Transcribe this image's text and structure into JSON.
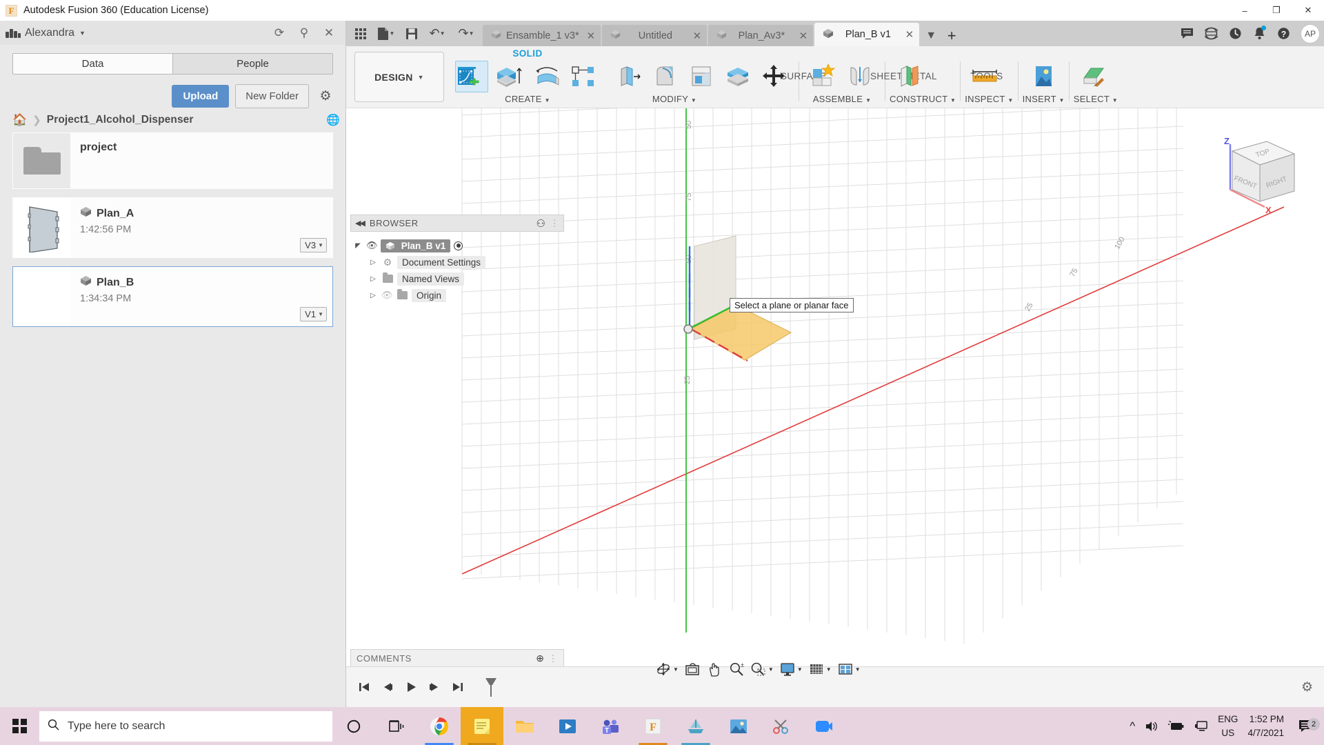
{
  "window": {
    "title": "Autodesk Fusion 360 (Education License)",
    "logo_letter": "F",
    "minimize": "–",
    "maximize": "❐",
    "close": "✕"
  },
  "data_panel": {
    "user": "Alexandra",
    "header_icons": [
      "refresh-icon",
      "search-icon",
      "close-icon"
    ],
    "tabs": [
      {
        "label": "Data",
        "active": true
      },
      {
        "label": "People",
        "active": false
      }
    ],
    "upload_label": "Upload",
    "new_folder_label": "New Folder",
    "breadcrumb": "Project1_Alcohol_Dispenser",
    "files": [
      {
        "name": "project",
        "time": "",
        "version": "",
        "type": "folder",
        "selected": false
      },
      {
        "name": "Plan_A",
        "time": "1:42:56 PM",
        "version": "V3",
        "type": "design",
        "selected": false
      },
      {
        "name": "Plan_B",
        "time": "1:34:34 PM",
        "version": "V1",
        "type": "design",
        "selected": true
      }
    ]
  },
  "fusion": {
    "quick_access": [
      "grid-apps-icon",
      "new-file-icon",
      "save-icon",
      "undo-icon",
      "redo-icon"
    ],
    "document_tabs": [
      {
        "label": "Ensamble_1 v3*",
        "active": false
      },
      {
        "label": "Untitled",
        "active": false
      },
      {
        "label": "Plan_Av3*",
        "active": false
      },
      {
        "label": "Plan_B v1",
        "active": true
      }
    ],
    "tabbar_right_icons": [
      "chevron-down-icon",
      "plus-icon",
      "comment-icon",
      "globe-icon",
      "recent-icon",
      "bell-icon",
      "help-icon"
    ],
    "avatar_initials": "AP",
    "workspace": "DESIGN",
    "ribbon_tabs": [
      {
        "label": "SOLID",
        "active": true
      },
      {
        "label": "SURFACE",
        "active": false
      },
      {
        "label": "SHEET METAL",
        "active": false
      },
      {
        "label": "TOOLS",
        "active": false
      }
    ],
    "ribbon_groups": [
      {
        "label": "CREATE"
      },
      {
        "label": "MODIFY"
      },
      {
        "label": "ASSEMBLE"
      },
      {
        "label": "CONSTRUCT"
      },
      {
        "label": "INSPECT"
      },
      {
        "label": "INSERT"
      },
      {
        "label": "SELECT"
      }
    ],
    "browser": {
      "title": "BROWSER",
      "root": "Plan_B v1",
      "items": [
        {
          "label": "Document Settings",
          "icon": "gear-icon",
          "hidden": false
        },
        {
          "label": "Named Views",
          "icon": "folder-icon",
          "hidden": false
        },
        {
          "label": "Origin",
          "icon": "folder-icon",
          "hidden": true
        }
      ]
    },
    "comments_label": "COMMENTS",
    "tooltip": "Select a plane or planar face",
    "viewcube": {
      "top": "TOP",
      "front": "FRONT",
      "right": "RIGHT",
      "z": "Z",
      "x": "X"
    },
    "canvas_ticks": [
      "50",
      "75",
      "50",
      "25",
      "100",
      "75",
      "25"
    ],
    "nav_icons": [
      "orbit-icon",
      "pan-fit-icon",
      "pan-icon",
      "zoom-icon",
      "zoom-window-icon",
      "display-settings-icon",
      "grid-snap-icon",
      "viewports-icon"
    ],
    "timeline_icons": [
      "skip-start-icon",
      "step-back-icon",
      "play-icon",
      "step-forward-icon",
      "skip-end-icon",
      "timeline-marker-icon"
    ],
    "timeline_settings_icon": "gear-icon"
  },
  "taskbar": {
    "search_placeholder": "Type here to search",
    "apps": [
      {
        "name": "cortana-icon",
        "color": "#1c1c1c"
      },
      {
        "name": "task-view-icon",
        "color": "#1c1c1c"
      },
      {
        "name": "chrome-icon",
        "color": "#4285f4"
      },
      {
        "name": "sticky-notes-icon",
        "color": "#f5c518"
      },
      {
        "name": "file-explorer-icon",
        "color": "#f0a030"
      },
      {
        "name": "movies-tv-icon",
        "color": "#4a90d9"
      },
      {
        "name": "teams-icon",
        "color": "#5b5fc7"
      },
      {
        "name": "fusion360-icon",
        "color": "#e08a1e"
      },
      {
        "name": "boat-app-icon",
        "color": "#4aa3c7"
      },
      {
        "name": "photos-icon",
        "color": "#3b8fd4"
      },
      {
        "name": "scissors-app-icon",
        "color": "#e05a5a"
      },
      {
        "name": "zoom-app-icon",
        "color": "#2d8cff"
      }
    ],
    "lang_line1": "ENG",
    "lang_line2": "US",
    "time": "1:52 PM",
    "date": "4/7/2021",
    "notification_count": "2"
  }
}
